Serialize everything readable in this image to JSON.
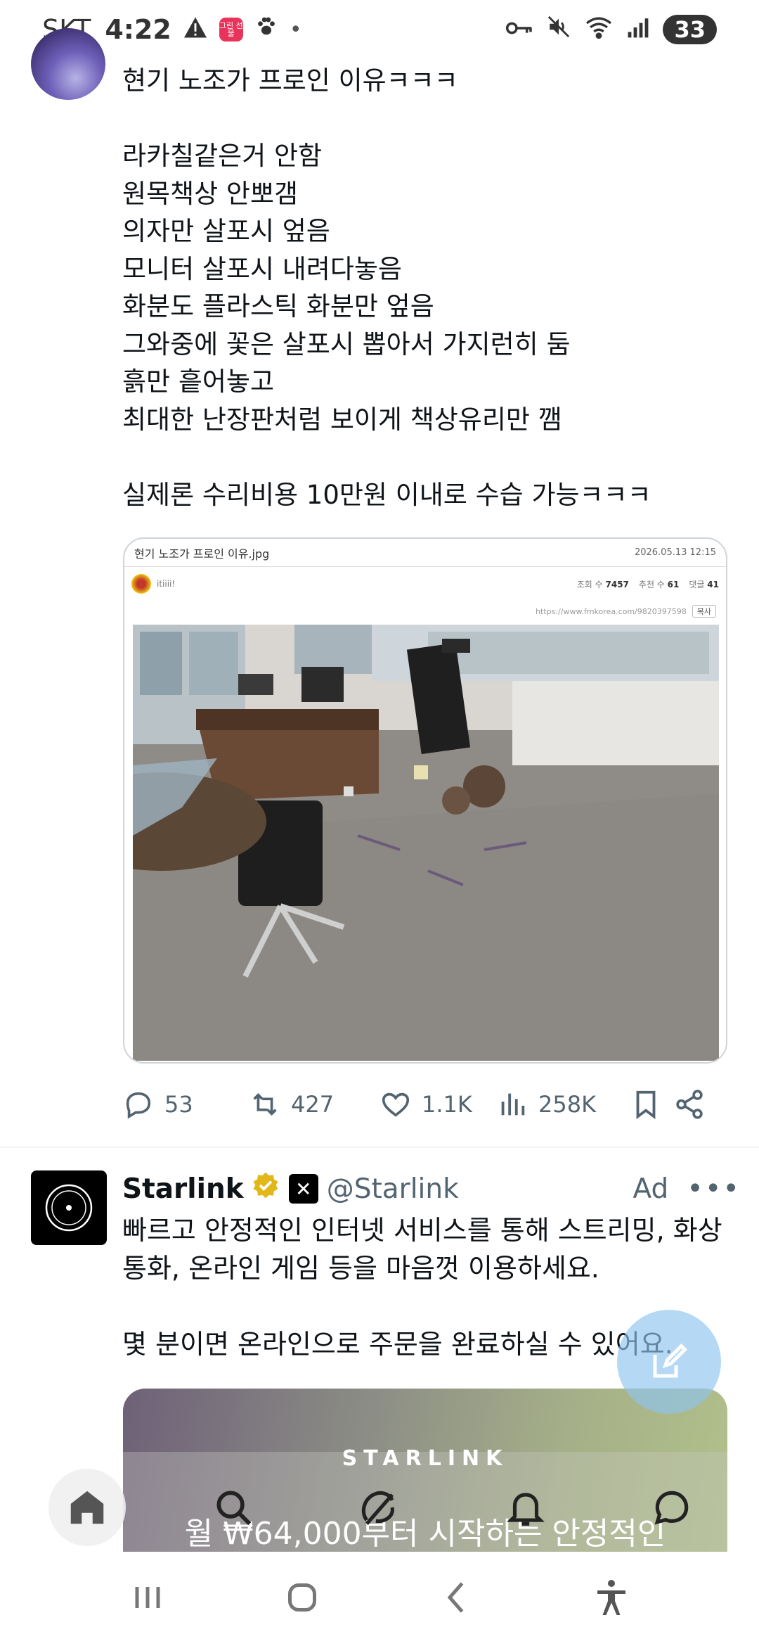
{
  "status_bar": {
    "carrier": "SKT",
    "time": "4:22",
    "app_badge": "그린\n선물",
    "battery": "33"
  },
  "tweet": {
    "text": "현기 노조가 프로인 이유ㅋㅋㅋ\n\n라카칠같은거 안함\n원목책상 안뽀갬\n의자만 살포시 엎음\n모니터 살포시 내려다놓음\n화분도 플라스틱 화분만 엎음\n그와중에 꽃은 살포시 뽑아서 가지런히 둠\n흙만 흩어놓고\n최대한 난장판처럼 보이게 책상유리만 깸\n\n실제론 수리비용 10만원 이내로 수습 가능ㅋㅋㅋ",
    "media": {
      "filename": "현기 노조가 프로인 이유.jpg",
      "date": "2026.05.13 12:15",
      "site": "itiiii!",
      "views_label": "조회 수",
      "views": "7457",
      "recommend_label": "추천 수",
      "recommend": "61",
      "comments_label": "댓글",
      "comments": "41",
      "url": "https://www.fmkorea.com/9820397598",
      "copy_label": "복사"
    },
    "actions": {
      "replies": "53",
      "retweets": "427",
      "likes": "1.1K",
      "views": "258K"
    }
  },
  "ad_tweet": {
    "name": "Starlink",
    "handle": "@Starlink",
    "ad_label": "Ad",
    "more": "•••",
    "text": "빠르고 안정적인 인터넷 서비스를 통해 스트리밍, 화상통화, 온라인 게임 등을 마음껏 이용하세요.\n\n몇 분이면 온라인으로 주문을 완료하실 수 있어요.",
    "card_brand": "STARLINK",
    "card_promo": "월 ₩64,000부터 시작하는 안정적인"
  },
  "colors": {
    "accent": "#1d9bf0",
    "secondary_text": "#536471",
    "gold_badge": "#e2b719"
  }
}
